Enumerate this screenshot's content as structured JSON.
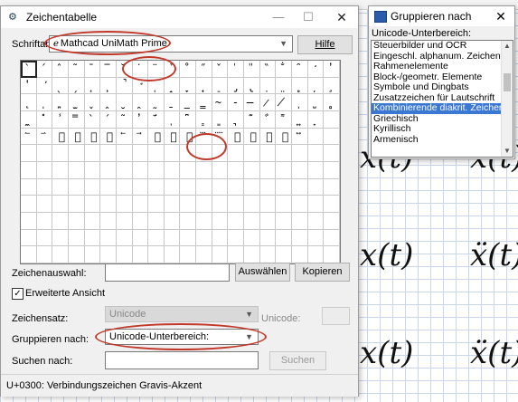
{
  "worksheet": {
    "math": [
      "x(t)",
      "x(t)",
      "x(t)",
      "ẍ(t)",
      "x(t)",
      "ẍ(t)"
    ]
  },
  "charmap": {
    "title": "Zeichentabelle",
    "font_label": "Schriftart:",
    "font_value": "Mathcad UniMath Prime",
    "font_icon_glyph": "ℯ",
    "help_button": "Hilfe",
    "chars": [
      [
        "̀",
        "́",
        "̂",
        "̃",
        "̄",
        "̅",
        "̆",
        "̇",
        "̈",
        "̉",
        "̊",
        "̋",
        "̌",
        "̍",
        "̎",
        "̏",
        "̐",
        "̑",
        "̒",
        "̓"
      ],
      [
        "̔",
        "̕",
        "̖",
        "̗",
        "̘",
        "̙",
        "̚",
        "̛",
        "̜",
        "̝",
        "̞",
        "̟",
        "̠",
        "̡",
        "̢",
        "̣",
        "̤",
        "̥",
        "̦",
        "̧"
      ],
      [
        "̨",
        "̩",
        "̪",
        "̫",
        "̬",
        "̭",
        "̮",
        "̯",
        "̰",
        "̱",
        "̲",
        "̳",
        "̴",
        "̵",
        "̶",
        "̷",
        "̸",
        "̹",
        "̺",
        "̻"
      ],
      [
        "̼",
        "̽",
        "̾",
        "̿",
        "̀",
        "́",
        "͂",
        "̓",
        "̈́",
        "ͅ",
        "͆",
        "͇",
        "͈",
        "͉",
        "͊",
        "͋",
        "͌",
        "͍",
        "͎",
        "͏"
      ],
      [
        "⃐",
        "⃑",
        "⃒",
        "⃓",
        "⃔",
        "⃕",
        "⃖",
        "⃗",
        "⃘",
        "⃙",
        "⃚",
        "⃛",
        "⃜",
        "⃝",
        "⃞",
        "⃟",
        "⃠",
        "⃡",
        "",
        ""
      ],
      [
        "",
        "",
        "",
        "",
        "",
        "",
        "",
        "",
        "",
        "",
        "",
        "",
        "",
        "",
        "",
        "",
        "",
        "",
        "",
        ""
      ],
      [
        "",
        "",
        "",
        "",
        "",
        "",
        "",
        "",
        "",
        "",
        "",
        "",
        "",
        "",
        "",
        "",
        "",
        "",
        "",
        ""
      ],
      [
        "",
        "",
        "",
        "",
        "",
        "",
        "",
        "",
        "",
        "",
        "",
        "",
        "",
        "",
        "",
        "",
        "",
        "",
        "",
        ""
      ],
      [
        "",
        "",
        "",
        "",
        "",
        "",
        "",
        "",
        "",
        "",
        "",
        "",
        "",
        "",
        "",
        "",
        "",
        "",
        "",
        ""
      ],
      [
        "",
        "",
        "",
        "",
        "",
        "",
        "",
        "",
        "",
        "",
        "",
        "",
        "",
        "",
        "",
        "",
        "",
        "",
        "",
        ""
      ],
      [
        "",
        "",
        "",
        "",
        "",
        "",
        "",
        "",
        "",
        "",
        "",
        "",
        "",
        "",
        "",
        "",
        "",
        "",
        "",
        ""
      ],
      [
        "",
        "",
        "",
        "",
        "",
        "",
        "",
        "",
        "",
        "",
        "",
        "",
        "",
        "",
        "",
        "",
        "",
        "",
        "",
        ""
      ]
    ],
    "selection_label": "Zeichenauswahl:",
    "select_button": "Auswählen",
    "copy_button": "Kopieren",
    "advanced_label": "Erweiterte Ansicht",
    "advanced_checked": "✓",
    "charset_label": "Zeichensatz:",
    "charset_value": "Unicode",
    "unicode_label": "Unicode:",
    "group_label": "Gruppieren nach:",
    "group_value": "Unicode-Unterbereich:",
    "search_label": "Suchen nach:",
    "search_button": "Suchen",
    "status": "U+0300: Verbindungszeichen Gravis-Akzent",
    "title_buttons": {
      "minimize": "—",
      "maximize": "☐",
      "close": "✕"
    }
  },
  "group": {
    "title": "Gruppieren nach",
    "close": "✕",
    "header": "Unicode-Unterbereich:",
    "items": [
      "Steuerbilder und OCR",
      "Eingeschl. alphanum. Zeichen",
      "Rahmenelemente",
      "Block-/geometr. Elemente",
      "Symbole und Dingbats",
      "Zusatzzeichen für Lautschrift",
      "Kombinierende diakrit. Zeichen",
      "Griechisch",
      "Kyrillisch",
      "Armenisch"
    ],
    "selected_index": 6,
    "scroll_up": "▲",
    "scroll_down": "▼"
  },
  "colors": {
    "annotation": "#c0392b",
    "selection": "#3a78d4"
  }
}
